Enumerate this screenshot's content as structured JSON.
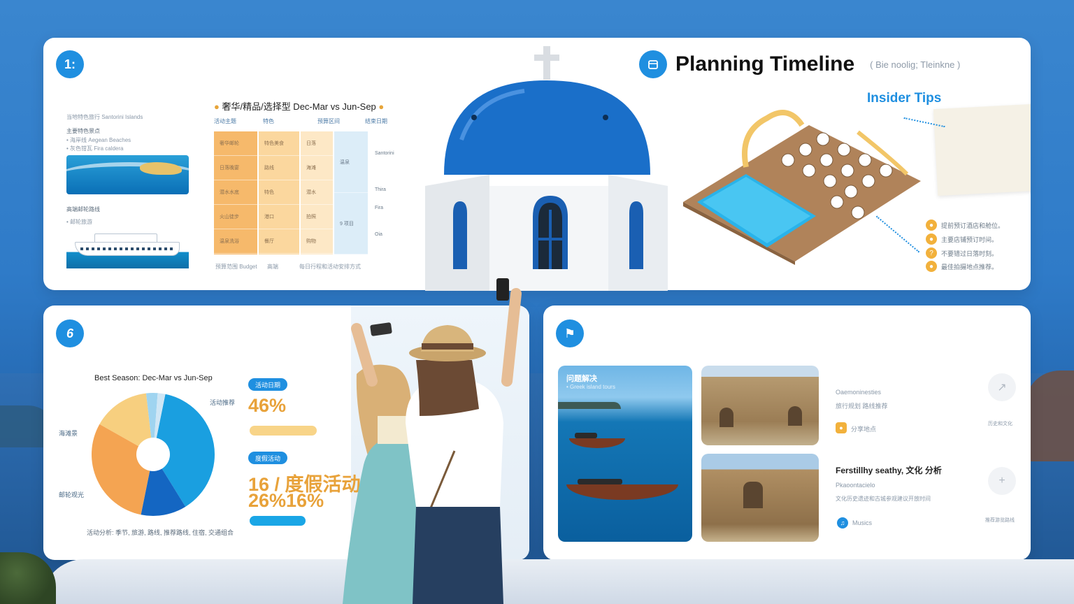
{
  "top_card": {
    "badge": "1:",
    "left": {
      "line1": "当地特色旅行 Santorini Islands",
      "line2": "主要特色景点",
      "line3": "• 海岸线 Aegean Beaches",
      "line4": "• 灰色钳瓦 Fira caldera",
      "line5": "高端邮轮路线",
      "line6": "• 邮轮旅游"
    },
    "season": {
      "title": "奢华/精品/选择型 Dec-Mar vs Jun-Sep",
      "headers": [
        "活动主题",
        "特色",
        "预算区间",
        "结束日期"
      ],
      "col1": [
        "奢华邮轮",
        "日落晚宴",
        "潜水水底",
        "火山徒步",
        "温泉洗浴"
      ],
      "col2": [
        "特色美食",
        "路线",
        "特色",
        "港口",
        "餐厅"
      ],
      "col3": [
        "日落",
        "海滩",
        "潜水",
        "拍照",
        "购物"
      ],
      "col4": [
        "温泉",
        "9 项目"
      ],
      "side": [
        "Santorini",
        "Thira",
        "Fira",
        "Oia"
      ],
      "footer": [
        "预算范围 Budget",
        "高端",
        "每日行程和活动安排方式"
      ]
    },
    "timeline": {
      "title": "Planning Timeline",
      "subtitle": "( Bie noolig; Tleinkne )",
      "insider_title": "Insider Tips",
      "tips": [
        "提前预订酒店和舱位。",
        "主要店铺预订时间。",
        "不要错过日落时刻。",
        "最佳拍摄地点推荐。"
      ]
    }
  },
  "bottom_left": {
    "badge": "6",
    "best_season": "Best Season: Dec-Mar vs Jun-Sep",
    "pie_labels": [
      "活动推荐",
      "海滩景",
      "邮轮观光"
    ],
    "stat1": {
      "pill": "活动日期",
      "value": "46%"
    },
    "stat2": {
      "pill": "度假活动",
      "value1": "16 / 度假活动",
      "value2": "26%16%"
    },
    "footer": "活动分析: 季节, 旅游, 路线, 推荐路线, 住宿, 交通组合",
    "colors": {
      "accent": "#1f8fe0",
      "orange": "#e8a23a"
    }
  },
  "bottom_right": {
    "badge": "⚑",
    "sea_tile_title": "问题解决",
    "sea_tile_sub": "• Greek island tours",
    "block1": {
      "line1": "Oaemoninesties",
      "line2": "旅行规划 路线推荐",
      "tag": "分享地点",
      "side": "历史和文化"
    },
    "block2": {
      "heading": "Ferstillhy seathy, 文化 分析",
      "line1": "Pkaoontacielo",
      "line2": "文化历史遗迹和古城参观建议开放时间",
      "tag": "Musics",
      "side": "推荐游览路线"
    }
  },
  "chart_data": {
    "type": "pie",
    "values": [
      38,
      12,
      30,
      15,
      3,
      2
    ],
    "colors": [
      "#1a9fe0",
      "#1466c2",
      "#f4a452",
      "#f7cf7f",
      "#9fd4f0",
      "#cfe6f5"
    ]
  }
}
